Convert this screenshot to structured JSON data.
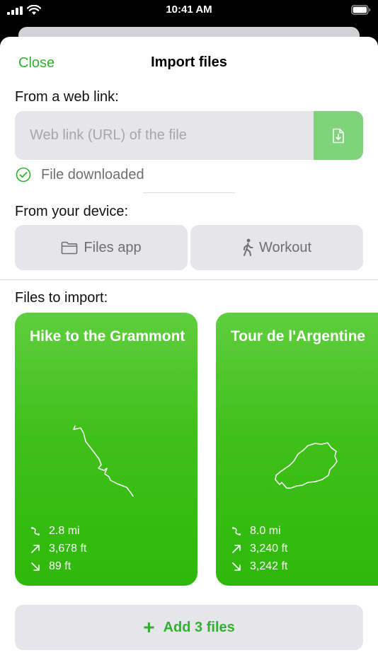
{
  "status_bar": {
    "time": "10:41 AM"
  },
  "nav": {
    "close_label": "Close",
    "title": "Import files"
  },
  "web_link": {
    "section_label": "From a web link:",
    "placeholder": "Web link (URL) of the file",
    "value": "",
    "download_icon": "file-download-icon",
    "status_text": "File downloaded",
    "status_icon": "checkmark-circle-icon"
  },
  "device": {
    "section_label": "From your device:",
    "files_label": "Files app",
    "files_icon": "folder-icon",
    "workout_label": "Workout",
    "workout_icon": "walking-figure-icon"
  },
  "import": {
    "section_label": "Files to import:",
    "cards": [
      {
        "title": "Hike to the Grammont",
        "distance": "2.8 mi",
        "ascent": "3,678 ft",
        "descent": "89 ft"
      },
      {
        "title": "Tour de l'Argentine",
        "distance": "8.0 mi",
        "ascent": "3,240 ft",
        "descent": "3,242 ft"
      }
    ]
  },
  "add_button": {
    "label": "Add 3 files"
  },
  "colors": {
    "accent": "#2fb12f",
    "card_green": "#3fc01a",
    "field_bg": "#e5e5ea"
  }
}
